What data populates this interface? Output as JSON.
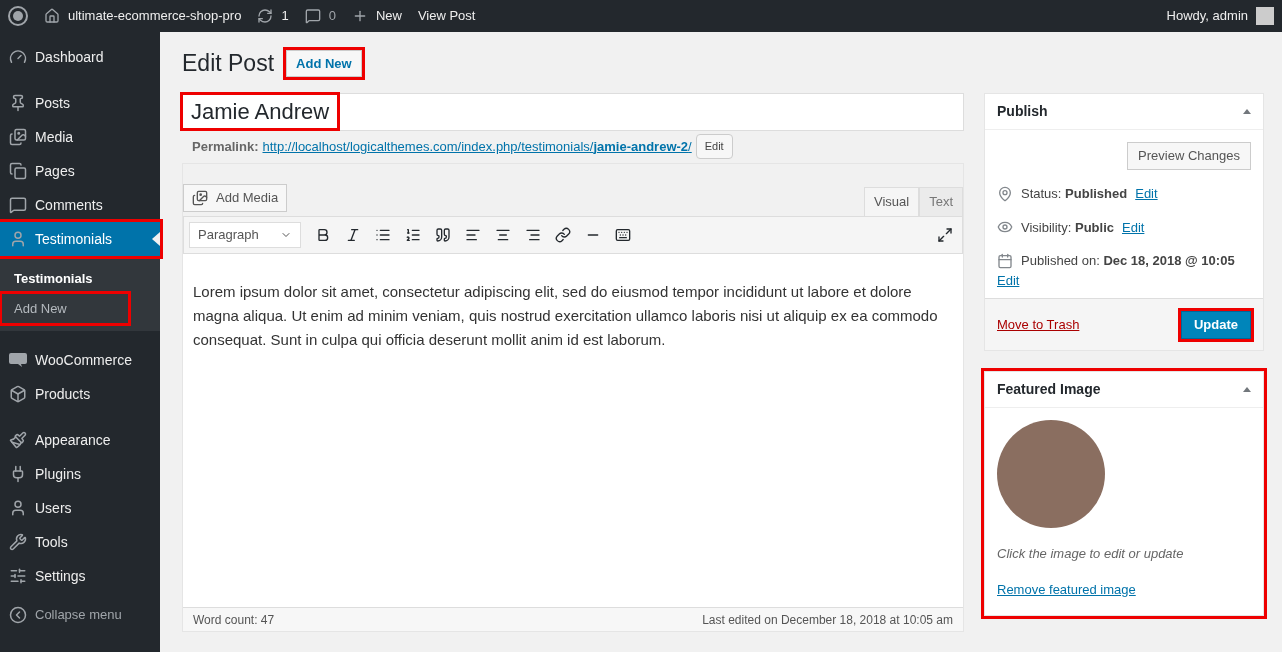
{
  "admin_bar": {
    "site_name": "ultimate-ecommerce-shop-pro",
    "updates": "1",
    "comments": "0",
    "new": "New",
    "view_post": "View Post",
    "greeting": "Howdy, admin"
  },
  "sidebar": {
    "groups": [
      [
        {
          "label": "Dashboard",
          "selected": false,
          "highlighted": false
        }
      ],
      [
        {
          "label": "Posts",
          "selected": false,
          "highlighted": false
        },
        {
          "label": "Media",
          "selected": false,
          "highlighted": false
        },
        {
          "label": "Pages",
          "selected": false,
          "highlighted": false
        },
        {
          "label": "Comments",
          "selected": false,
          "highlighted": false
        },
        {
          "label": "Testimonials",
          "selected": true,
          "highlighted": true,
          "submenu": [
            {
              "label": "Testimonials",
              "selected": true,
              "highlighted": false
            },
            {
              "label": "Add New",
              "selected": false,
              "highlighted": true
            }
          ]
        }
      ],
      [
        {
          "label": "WooCommerce",
          "selected": false,
          "highlighted": false
        },
        {
          "label": "Products",
          "selected": false,
          "highlighted": false
        }
      ],
      [
        {
          "label": "Appearance",
          "selected": false,
          "highlighted": false
        },
        {
          "label": "Plugins",
          "selected": false,
          "highlighted": false
        },
        {
          "label": "Users",
          "selected": false,
          "highlighted": false
        },
        {
          "label": "Tools",
          "selected": false,
          "highlighted": false
        },
        {
          "label": "Settings",
          "selected": false,
          "highlighted": false
        }
      ]
    ],
    "collapse": "Collapse menu"
  },
  "heading": {
    "title": "Edit Post",
    "add_new": "Add New",
    "add_new_highlighted": true
  },
  "post": {
    "title": "Jamie Andrew",
    "title_highlighted": true,
    "permalink_label": "Permalink:",
    "permalink_base": "http://localhost/logicalthemes.com/index.php/testimonials/",
    "permalink_slug": "jamie-andrew-2",
    "permalink_end": "/",
    "permalink_edit": "Edit"
  },
  "editor": {
    "add_media": "Add Media",
    "tabs": [
      {
        "label": "Visual",
        "selected": true
      },
      {
        "label": "Text",
        "selected": false
      }
    ],
    "format": "Paragraph",
    "content": "Lorem ipsum dolor sit amet, consectetur adipiscing elit, sed do eiusmod tempor incididunt ut labore et dolore magna aliqua. Ut enim ad minim veniam, quis nostrud exercitation ullamco laboris nisi ut aliquip ex ea commodo consequat. Sunt in culpa qui officia deserunt mollit anim id est laborum.",
    "word_count": "Word count: 47",
    "last_edited": "Last edited on December 18, 2018 at 10:05 am"
  },
  "publish": {
    "title": "Publish",
    "preview": "Preview Changes",
    "status_label": "Status:",
    "status": "Published",
    "visibility_label": "Visibility:",
    "visibility": "Public",
    "published_label": "Published on:",
    "published": "Dec 18, 2018 @ 10:05",
    "edit": [
      "Edit",
      "Edit",
      "Edit"
    ],
    "trash": "Move to Trash",
    "update": "Update",
    "update_highlighted": true
  },
  "featured_image": {
    "title": "Featured Image",
    "highlighted": true,
    "hint": "Click the image to edit or update",
    "remove": "Remove featured image"
  }
}
